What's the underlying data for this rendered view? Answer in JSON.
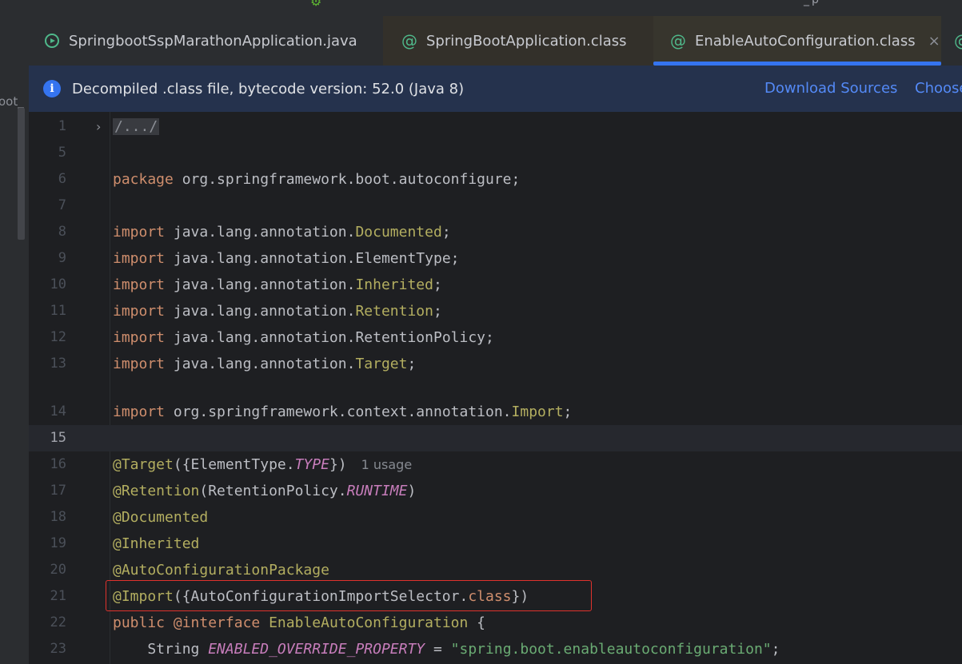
{
  "window": {
    "title_fragment": "_p"
  },
  "project_panel": {
    "fragment": "oot_"
  },
  "tabs": [
    {
      "label": "SpringbootSspMarathonApplication.java",
      "icon": "spring-run-icon"
    },
    {
      "label": "SpringBootApplication.class",
      "icon": "annotation-icon"
    },
    {
      "label": "EnableAutoConfiguration.class",
      "icon": "annotation-icon",
      "active": true,
      "close_icon": "×"
    }
  ],
  "banner": {
    "message": "Decompiled .class file, bytecode version: 52.0 (Java 8)",
    "download_label": "Download Sources",
    "choose_label": "Choose"
  },
  "editor": {
    "line_numbers": [
      "1",
      "5",
      "6",
      "7",
      "8",
      "9",
      "10",
      "11",
      "12",
      "13",
      "14",
      "15",
      "16",
      "17",
      "18",
      "19",
      "20",
      "21",
      "22",
      "23"
    ],
    "collapsed_header": "/.../",
    "usage_hint": "1 usage",
    "current_line": "15",
    "highlighted_line": "21",
    "lines": {
      "l6": {
        "kw": "package",
        "rest": " org.springframework.boot.autoconfigure;"
      },
      "l8": {
        "kw": "import",
        "pkg": " java.lang.annotation.",
        "cls": "Documented",
        "end": ";"
      },
      "l9": {
        "kw": "import",
        "pkg": " java.lang.annotation.",
        "cls": "ElementType",
        "end": ";"
      },
      "l10": {
        "kw": "import",
        "pkg": " java.lang.annotation.",
        "cls": "Inherited",
        "end": ";"
      },
      "l11": {
        "kw": "import",
        "pkg": " java.lang.annotation.",
        "cls": "Retention",
        "end": ";"
      },
      "l12": {
        "kw": "import",
        "pkg": " java.lang.annotation.",
        "cls": "RetentionPolicy",
        "end": ";"
      },
      "l13": {
        "kw": "import",
        "pkg": " java.lang.annotation.",
        "cls": "Target",
        "end": ";"
      },
      "l14": {
        "kw": "import",
        "pkg": " org.springframework.context.annotation.",
        "cls": "Import",
        "end": ";"
      },
      "l16": {
        "ann": "@Target",
        "a": "({ElementType.",
        "b": "TYPE",
        "c": "})"
      },
      "l17": {
        "ann": "@Retention",
        "a": "(RetentionPolicy.",
        "b": "RUNTIME",
        "c": ")"
      },
      "l18": {
        "ann": "@Documented"
      },
      "l19": {
        "ann": "@Inherited"
      },
      "l20": {
        "ann": "@AutoConfigurationPackage"
      },
      "l21": {
        "ann": "@Import",
        "a": "({AutoConfigurationImportSelector.",
        "kw": "class",
        "c": "})"
      },
      "l22": {
        "kw1": "public",
        "ann": " @interface",
        "sp": " ",
        "name": "EnableAutoConfiguration",
        "end": " {"
      },
      "l23": {
        "indent": "    ",
        "type": "String ",
        "field": "ENABLED_OVERRIDE_PROPERTY",
        "eq": " = ",
        "str": "\"spring.boot.enableautoconfiguration\"",
        "end": ";"
      }
    }
  },
  "colors": {
    "background": "#1e1f22",
    "keyword": "#cf8e6d",
    "annotation": "#b3ae60",
    "constant": "#c77dbb",
    "string": "#6aab73",
    "link": "#548af7",
    "highlight_box": "#e0322d"
  }
}
